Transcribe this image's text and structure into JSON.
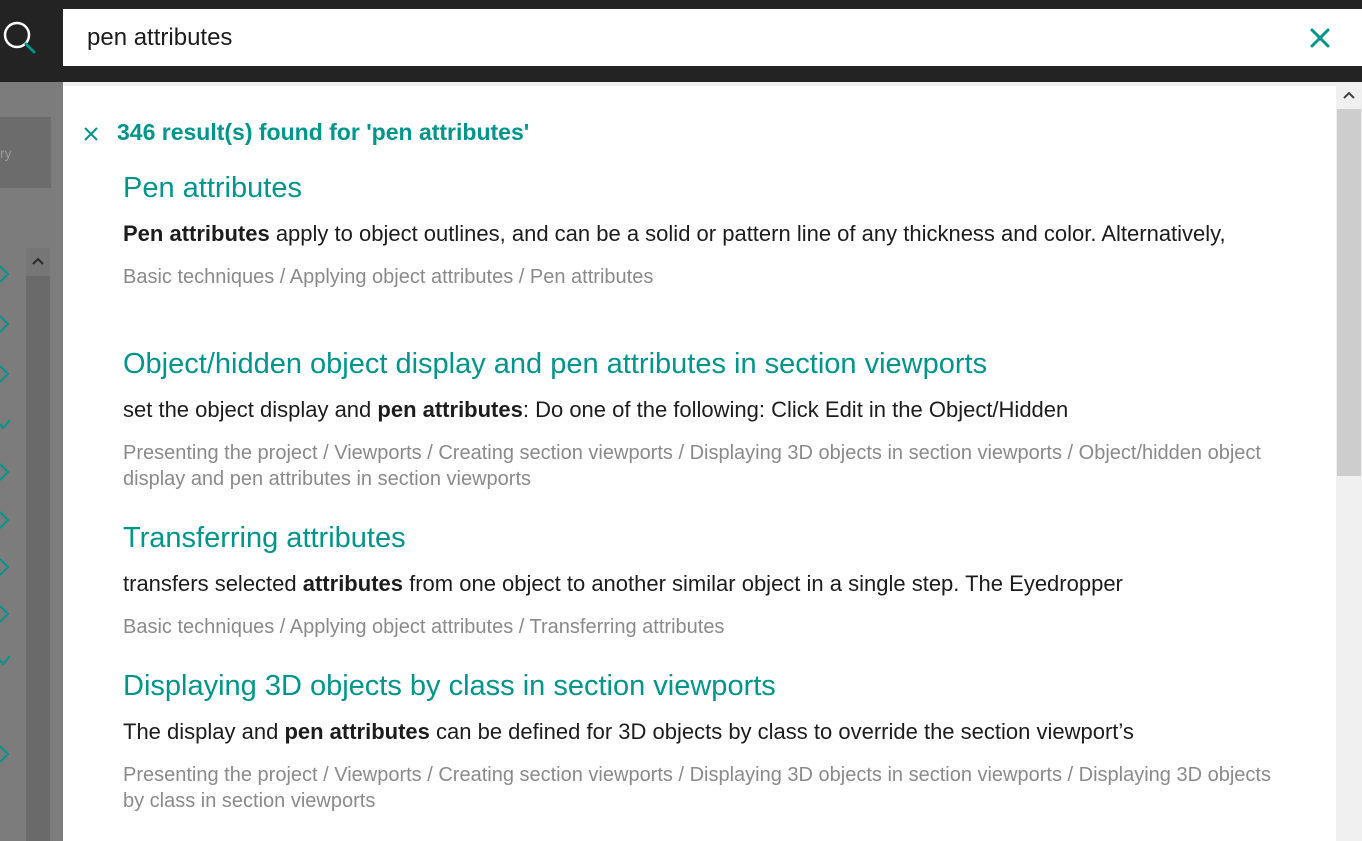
{
  "search": {
    "query": "pen attributes",
    "search_icon": "search-icon",
    "clear_icon": "close-icon"
  },
  "left_panel": {
    "button_fragment": "ry"
  },
  "results": {
    "summary": "346 result(s) found for 'pen attributes'",
    "items": [
      {
        "title": "Pen attributes",
        "snippet_pre": "",
        "snippet_bold": "Pen attributes",
        "snippet_post": " apply to object outlines, and can be a solid or pattern line of any thickness and color. Alternatively,",
        "path": "Basic techniques / Applying object attributes / Pen attributes"
      },
      {
        "title": "Object/hidden object display and pen attributes in section viewports",
        "snippet_pre": "set the object display and ",
        "snippet_bold": "pen attributes",
        "snippet_post": ": Do one of the following: Click Edit in the Object/Hidden",
        "path": "Presenting the project / Viewports / Creating section viewports / Displaying 3D objects in section viewports / Object/hidden object display and pen attributes in section viewports"
      },
      {
        "title": "Transferring attributes",
        "snippet_pre": "transfers selected ",
        "snippet_bold": "attributes",
        "snippet_post": " from one object to another similar object in a single step. The Eyedropper",
        "path": "Basic techniques / Applying object attributes / Transferring attributes"
      },
      {
        "title": "Displaying 3D objects by class in section viewports",
        "snippet_pre": "The display and ",
        "snippet_bold": "pen attributes",
        "snippet_post": " can be defined for 3D objects by class to override the section viewport’s",
        "path": "Presenting the project / Viewports / Creating section viewports / Displaying 3D objects in section viewports / Displaying 3D objects by class in section viewports"
      }
    ]
  },
  "colors": {
    "accent": "#00958b",
    "topbar": "#232323",
    "snippet_text": "#1c1c1c",
    "path_text": "#8a8a8a"
  }
}
